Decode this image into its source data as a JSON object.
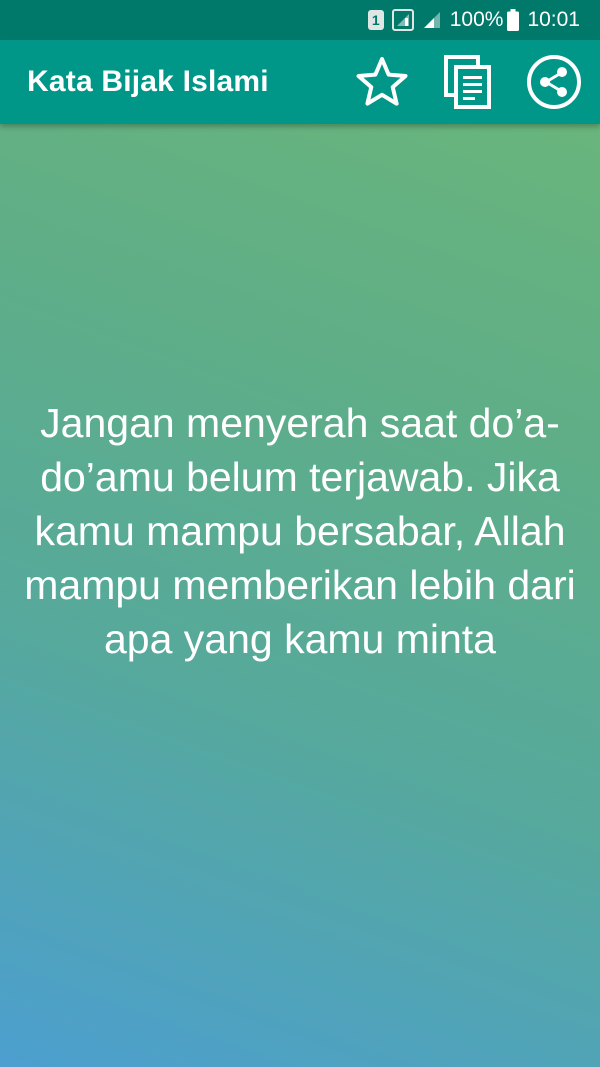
{
  "status_bar": {
    "sim_label": "1",
    "battery_percent": "100%",
    "time": "10:01"
  },
  "app_bar": {
    "title": "Kata Bijak Islami",
    "actions": [
      {
        "icon": "star-outline-icon"
      },
      {
        "icon": "copy-icon"
      },
      {
        "icon": "share-icon"
      }
    ]
  },
  "quote": {
    "text": "Jangan menyerah saat do’a-do’amu belum terjawab. Jika kamu mampu bersabar, Allah mampu memberikan lebih dari apa yang kamu minta"
  },
  "colors": {
    "status_bar": "#00796b",
    "app_bar": "#009688",
    "gradient_top": "#6db878",
    "gradient_bottom": "#4c9fcf"
  }
}
